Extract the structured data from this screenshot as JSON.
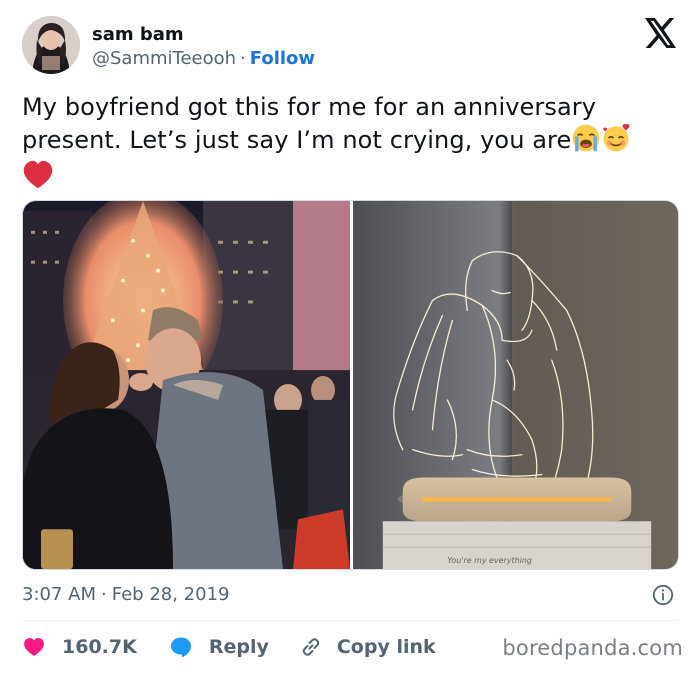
{
  "author": {
    "name": "sam bam",
    "handle": "@SammiTeeooh",
    "separator": "·",
    "follow_label": "Follow"
  },
  "tweet": {
    "text_line1": "My boyfriend got this for me for an anniversary",
    "text_line2": "present. Let’s just say I’m not crying, you are",
    "emojis": [
      "loudly-crying-face-emoji",
      "smiling-face-with-hearts-emoji",
      "red-heart-emoji"
    ]
  },
  "media": {
    "photo_left": "couple-kissing-christmas-tree-photo",
    "photo_right": "engraved-acrylic-led-lamp-photo",
    "lamp_base_text": "You're my everything"
  },
  "meta": {
    "time": "3:07 AM",
    "separator": "·",
    "date": "Feb 28, 2019"
  },
  "actions": {
    "like_count": "160.7K",
    "reply_label": "Reply",
    "copy_label": "Copy link"
  },
  "watermark": "boredpanda.com",
  "colors": {
    "follow_blue": "#1d74d9",
    "like_red": "#f91880",
    "reply_blue": "#1d9bf0",
    "secondary_text": "#536471"
  }
}
